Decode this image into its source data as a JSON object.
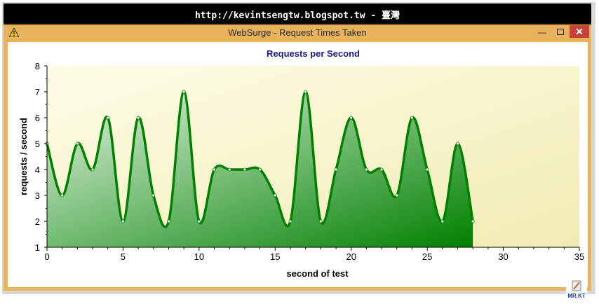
{
  "banner": {
    "text": "http://kevintsengtw.blogspot.tw - 臺灣"
  },
  "window": {
    "title": "WebSurge - Request Times Taken",
    "min_glyph": "—",
    "close_glyph": "✕"
  },
  "logo": {
    "text": "MR.KT"
  },
  "colors": {
    "accent": "#008000",
    "plot_bg": "#fcfad8",
    "title": "#1a1a8c",
    "titlebar": "#e8b35c",
    "close": "#c7413a"
  },
  "chart_data": {
    "type": "area",
    "title": "Requests per Second",
    "xlabel": "second of test",
    "ylabel": "requests / second",
    "xlim": [
      0,
      35
    ],
    "ylim": [
      1,
      8
    ],
    "xticks": [
      0,
      5,
      10,
      15,
      20,
      25,
      30,
      35
    ],
    "yticks": [
      1,
      2,
      3,
      4,
      5,
      6,
      7,
      8
    ],
    "grid": false,
    "x": [
      0,
      1,
      2,
      3,
      4,
      5,
      6,
      7,
      8,
      9,
      10,
      11,
      12,
      13,
      14,
      15,
      16,
      17,
      18,
      19,
      20,
      21,
      22,
      23,
      24,
      25,
      26,
      27,
      28
    ],
    "values": [
      5,
      3,
      5,
      4,
      6,
      2,
      6,
      3,
      2,
      7,
      2,
      4,
      4,
      4,
      4,
      3,
      2,
      7,
      2,
      4,
      6,
      4,
      4,
      3,
      6,
      4,
      2,
      5,
      2
    ]
  }
}
